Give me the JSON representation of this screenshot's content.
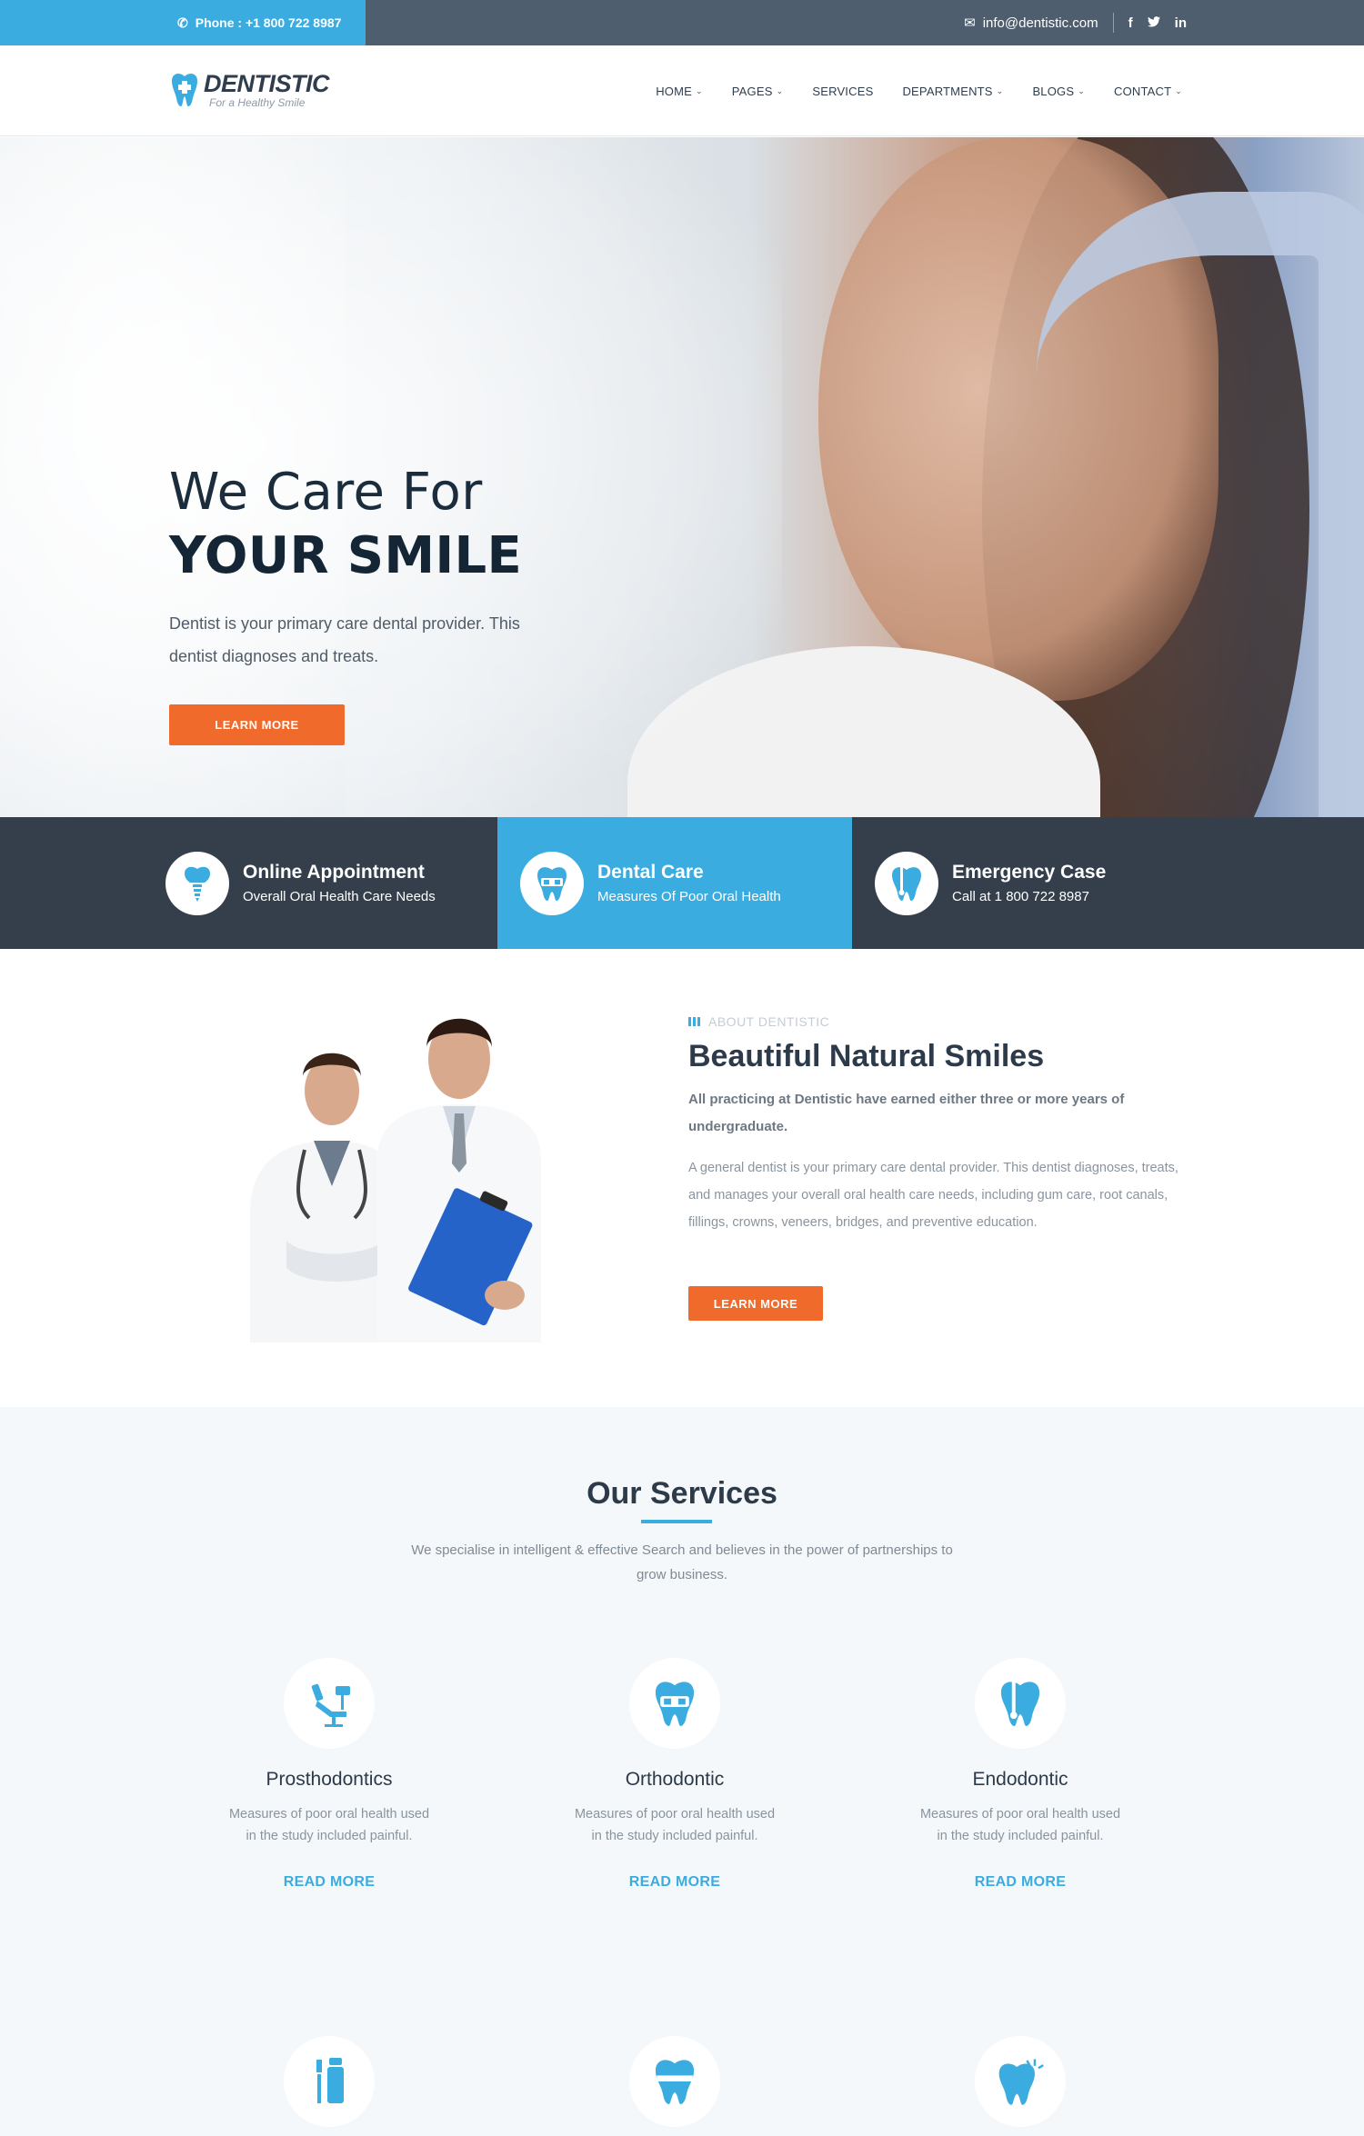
{
  "topbar": {
    "phone": "Phone : +1 800 722 8987",
    "email": "info@dentistic.com",
    "social": [
      "f",
      "t",
      "in"
    ]
  },
  "header": {
    "logo_name": "DENTISTIC",
    "logo_tag": "For a Healthy Smile",
    "nav": [
      {
        "label": "HOME",
        "dropdown": true
      },
      {
        "label": "PAGES",
        "dropdown": true
      },
      {
        "label": "SERVICES",
        "dropdown": false
      },
      {
        "label": "DEPARTMENTS",
        "dropdown": true
      },
      {
        "label": "BLOGS",
        "dropdown": true
      },
      {
        "label": "CONTACT",
        "dropdown": true
      }
    ]
  },
  "hero": {
    "line1": "We Care For",
    "line2": "YOUR SMILE",
    "text": "Dentist is your primary care dental provider. This dentist diagnoses and treats.",
    "button": "LEARN MORE"
  },
  "features": [
    {
      "title": "Online Appointment",
      "subtitle": "Overall Oral Health Care Needs",
      "icon": "implant-tooth-icon"
    },
    {
      "title": "Dental Care",
      "subtitle": "Measures Of Poor Oral Health",
      "icon": "braces-tooth-icon"
    },
    {
      "title": "Emergency Case",
      "subtitle": "Call at 1 800 722 8987",
      "icon": "root-canal-tooth-icon"
    }
  ],
  "about": {
    "kicker": "ABOUT DENTISTIC",
    "title": "Beautiful Natural Smiles",
    "lead": "All practicing at Dentistic have earned either three or more years of undergraduate.",
    "body": "A general dentist is your primary care dental provider. This dentist diagnoses, treats, and manages your overall oral health care needs, including gum care, root canals, fillings, crowns, veneers, bridges, and preventive education.",
    "button": "LEARN MORE"
  },
  "services": {
    "title": "Our Services",
    "subtitle": "We specialise in intelligent & effective Search and believes in the power of partnerships to grow business.",
    "items": [
      {
        "name": "Prosthodontics",
        "desc": "Measures of poor oral health used in the study included painful.",
        "more": "READ MORE",
        "icon": "dental-chair-icon"
      },
      {
        "name": "Orthodontic",
        "desc": "Measures of poor oral health used in the study included painful.",
        "more": "READ MORE",
        "icon": "braces-tooth-icon"
      },
      {
        "name": "Endodontic",
        "desc": "Measures of poor oral health used in the study included painful.",
        "more": "READ MORE",
        "icon": "root-canal-tooth-icon"
      }
    ],
    "second_row_icons": [
      "toothbrush-paste-icon",
      "tooth-band-icon",
      "sparkling-tooth-icon"
    ]
  },
  "colors": {
    "accent": "#3bace0",
    "orange": "#f06a2c",
    "dark": "#343f4b"
  }
}
